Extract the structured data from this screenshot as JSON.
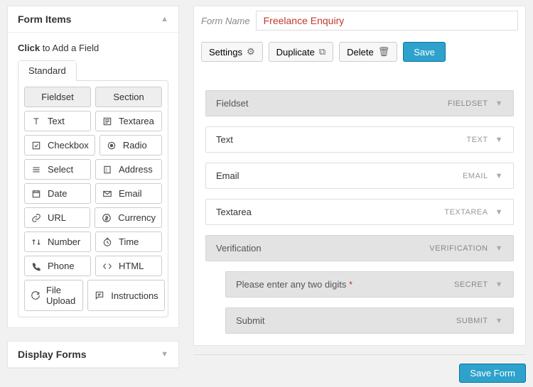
{
  "left": {
    "formItems": {
      "title": "Form Items",
      "clickPrefix": "Click",
      "clickRest": " to Add a Field",
      "tab": "Standard",
      "headerFieldset": "Fieldset",
      "headerSection": "Section",
      "rows": [
        {
          "l": "Text",
          "r": "Textarea"
        },
        {
          "l": "Checkbox",
          "r": "Radio"
        },
        {
          "l": "Select",
          "r": "Address"
        },
        {
          "l": "Date",
          "r": "Email"
        },
        {
          "l": "URL",
          "r": "Currency"
        },
        {
          "l": "Number",
          "r": "Time"
        },
        {
          "l": "Phone",
          "r": "HTML"
        },
        {
          "l": "File Upload",
          "r": "Instructions"
        }
      ]
    },
    "displayForms": {
      "title": "Display Forms"
    }
  },
  "right": {
    "formNameLabel": "Form Name",
    "formNameValue": "Freelance Enquiry",
    "toolbar": {
      "settings": "Settings",
      "duplicate": "Duplicate",
      "delete": "Delete",
      "save": "Save"
    },
    "rows": [
      {
        "label": "Fieldset",
        "type": "FIELDSET",
        "style": "grey"
      },
      {
        "label": "Text",
        "type": "TEXT",
        "style": "white"
      },
      {
        "label": "Email",
        "type": "EMAIL",
        "style": "white"
      },
      {
        "label": "Textarea",
        "type": "TEXTAREA",
        "style": "white"
      },
      {
        "label": "Verification",
        "type": "VERIFICATION",
        "style": "grey"
      }
    ],
    "secret": {
      "label": "Please enter any two digits",
      "req": "*",
      "type": "SECRET"
    },
    "submit": {
      "label": "Submit",
      "type": "SUBMIT"
    },
    "saveForm": "Save Form"
  }
}
